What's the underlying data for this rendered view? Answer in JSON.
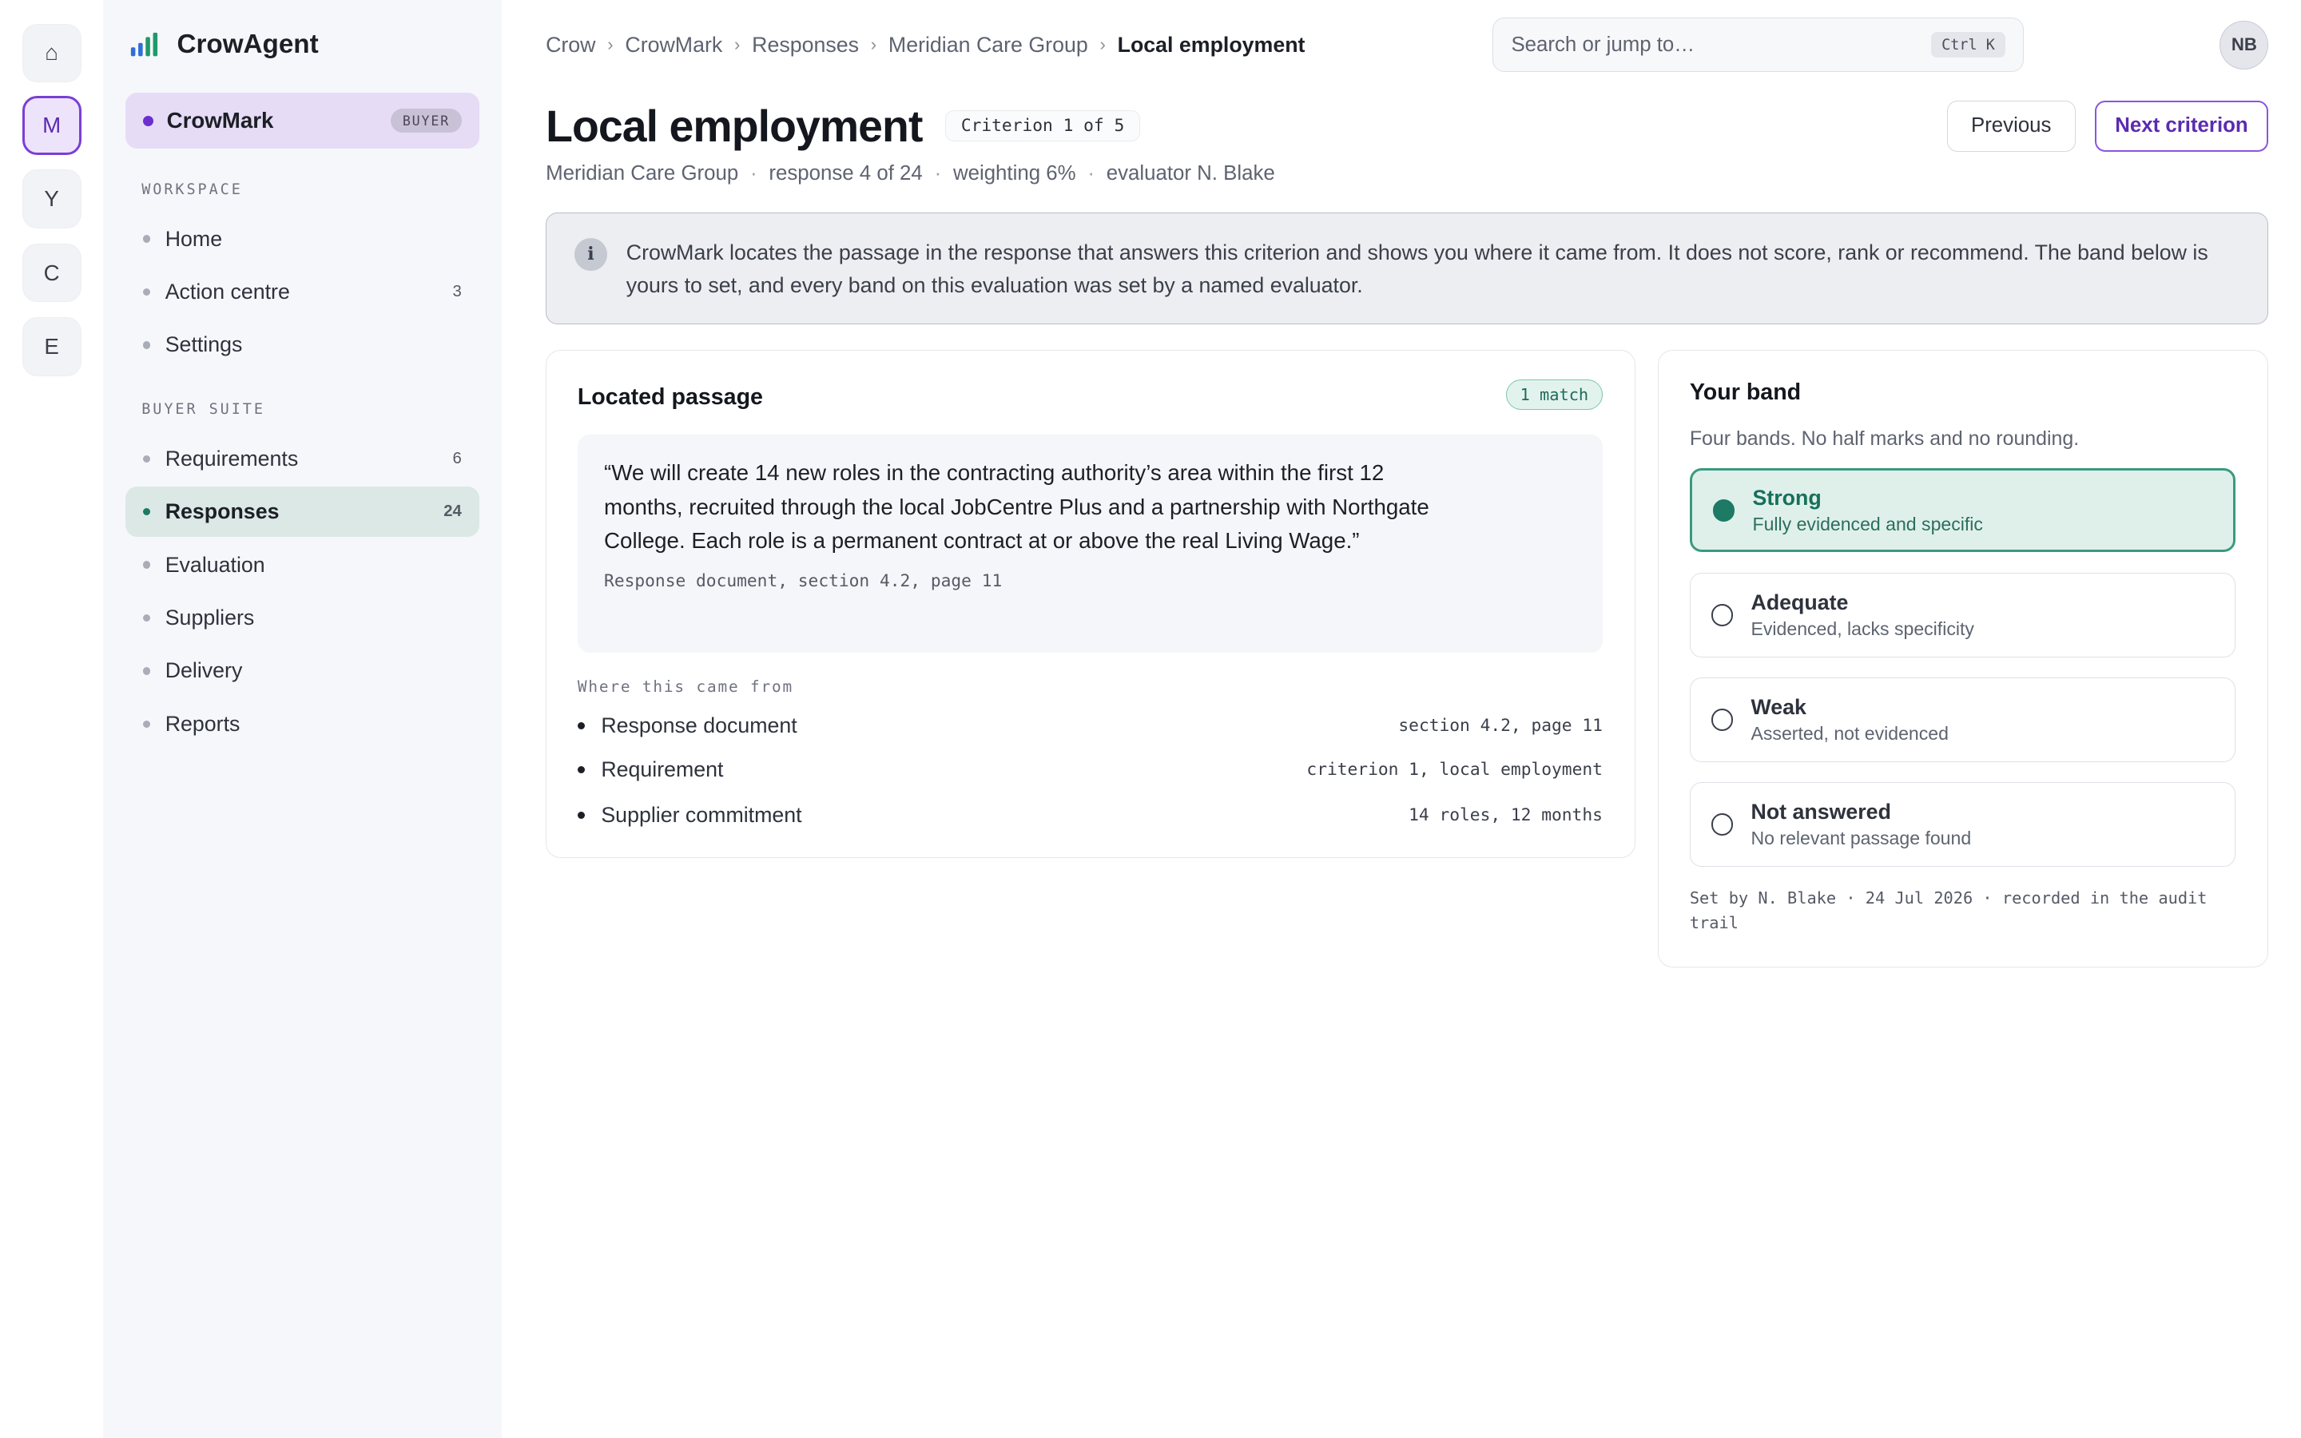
{
  "rail": {
    "items": [
      {
        "label": "⌂",
        "icon": "home-icon"
      },
      {
        "label": "M"
      },
      {
        "label": "Y"
      },
      {
        "label": "C"
      },
      {
        "label": "E"
      }
    ]
  },
  "sidebar": {
    "brand": "CrowAgent",
    "app": {
      "name": "CrowMark",
      "badge": "BUYER"
    },
    "workspace_label": "WORKSPACE",
    "workspace": [
      {
        "label": "Home",
        "count": ""
      },
      {
        "label": "Action centre",
        "count": "3"
      },
      {
        "label": "Settings",
        "count": ""
      }
    ],
    "suite_label": "BUYER SUITE",
    "suite": [
      {
        "label": "Requirements",
        "count": "6"
      },
      {
        "label": "Responses",
        "count": "24"
      },
      {
        "label": "Evaluation",
        "count": ""
      },
      {
        "label": "Suppliers",
        "count": ""
      },
      {
        "label": "Delivery",
        "count": ""
      },
      {
        "label": "Reports",
        "count": ""
      }
    ]
  },
  "breadcrumb": [
    "Crow",
    "CrowMark",
    "Responses",
    "Meridian Care Group",
    "Local employment"
  ],
  "search": {
    "placeholder": "Search or jump to…",
    "shortcut": "Ctrl K"
  },
  "user": {
    "initials": "NB"
  },
  "header": {
    "title": "Local employment",
    "criterion_chip": "Criterion 1 of 5",
    "meta": [
      "Meridian Care Group",
      "response 4 of 24",
      "weighting 6%",
      "evaluator N. Blake"
    ],
    "previous_label": "Previous",
    "next_label": "Next criterion"
  },
  "notice": {
    "icon": "i",
    "text": "CrowMark locates the passage in the response that answers this criterion and shows you where it came from. It does not score, rank or recommend. The band below is yours to set, and every band on this evaluation was set by a named evaluator."
  },
  "passage": {
    "title": "Located passage",
    "match": "1 match",
    "quote": "“We will create 14 new roles in the contracting authority’s area within the first 12 months, recruited through the local JobCentre Plus and a partnership with Northgate College. Each role is a permanent contract at or above the real Living Wage.”",
    "quote_source": "Response document, section 4.2, page 11",
    "sources_label": "Where this came from",
    "sources": [
      {
        "label": "Response document",
        "value": "section 4.2, page 11"
      },
      {
        "label": "Requirement",
        "value": "criterion 1, local employment"
      },
      {
        "label": "Supplier commitment",
        "value": "14 roles, 12 months"
      }
    ]
  },
  "band": {
    "title": "Your band",
    "subtitle": "Four bands. No half marks and no rounding.",
    "options": [
      {
        "name": "Strong",
        "desc": "Fully evidenced and specific",
        "selected": true
      },
      {
        "name": "Adequate",
        "desc": "Evidenced, lacks specificity",
        "selected": false
      },
      {
        "name": "Weak",
        "desc": "Asserted, not evidenced",
        "selected": false
      },
      {
        "name": "Not answered",
        "desc": "No relevant passage found",
        "selected": false
      }
    ],
    "footer": "Set by N. Blake · 24 Jul 2026 · recorded in the audit trail"
  },
  "colors": {
    "accent": "#6b2fd0",
    "selected_band": "#1d7a64",
    "responses_active": "#dbe8e6"
  }
}
